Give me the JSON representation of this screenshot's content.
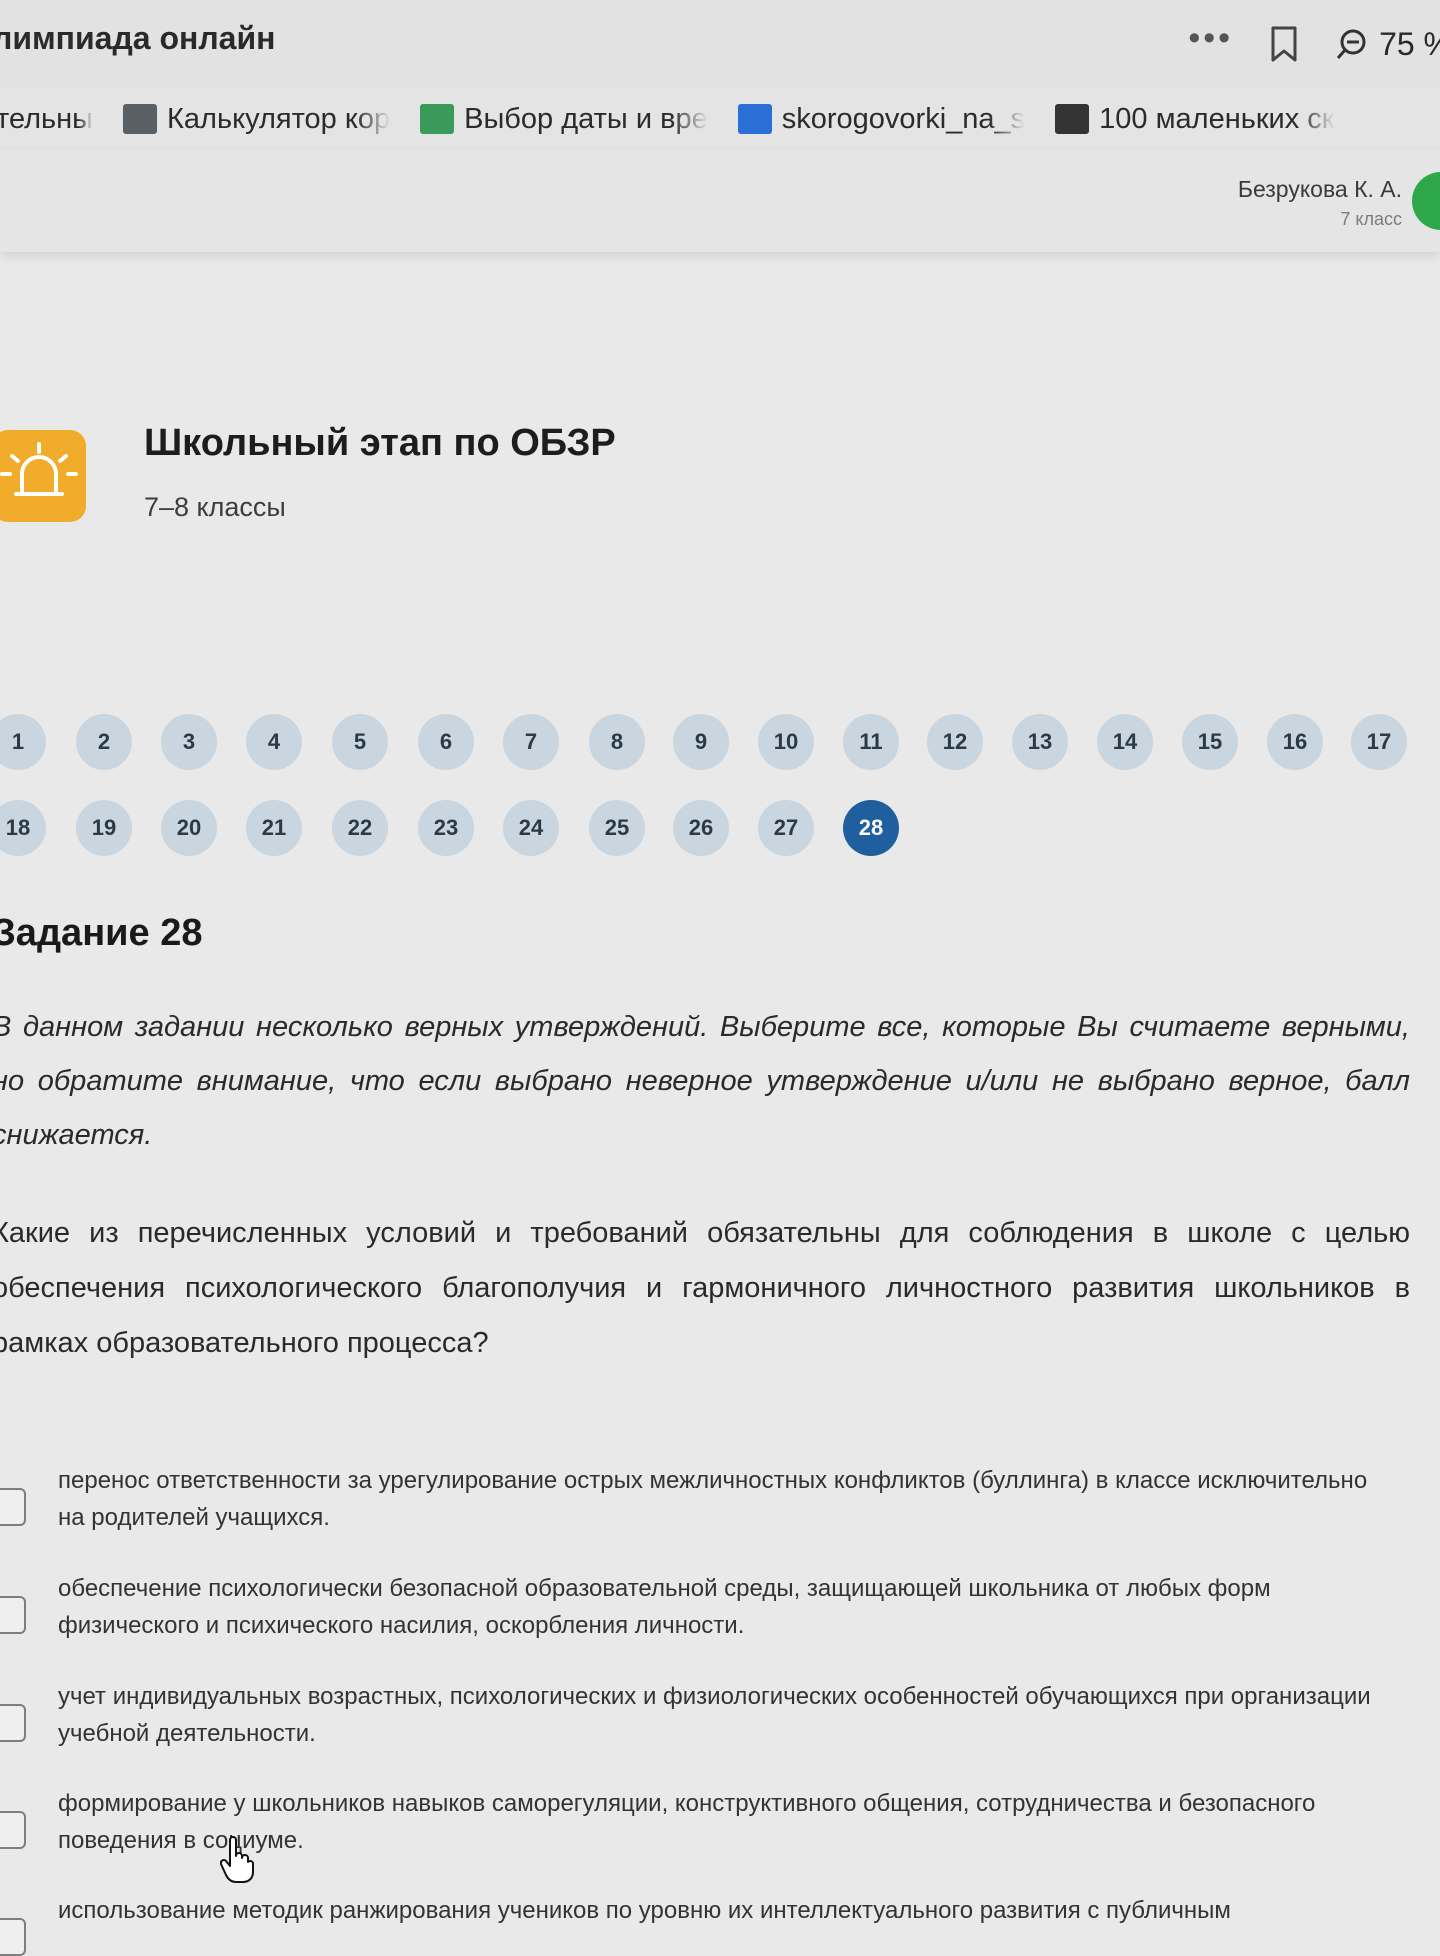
{
  "window": {
    "title": "лимпиада онлайн",
    "menu_icon": "more-dots-icon",
    "zoom": "75 %"
  },
  "bookmarks": [
    {
      "label": "тельны",
      "icon": "page-icon",
      "color": "#e4e4e4"
    },
    {
      "label": "Калькулятор кор",
      "icon": "calculator-icon",
      "color": "#5a5f66"
    },
    {
      "label": "Выбор даты и вре",
      "icon": "calendar-icon",
      "color": "#3a9a5a"
    },
    {
      "label": "skorogovorki_na_s",
      "icon": "document-icon",
      "color": "#2a6fd6"
    },
    {
      "label": "100 маленьких ск",
      "icon": "infinity-icon",
      "color": "#333333"
    }
  ],
  "user": {
    "name": "Безрукова К. А.",
    "class": "7 класс"
  },
  "olympiad": {
    "title": "Школьный этап по ОБЗР",
    "subtitle": "7–8 классы",
    "icon": "siren-icon",
    "icon_color": "#f0ac2a"
  },
  "question_nav": {
    "items": [
      "1",
      "2",
      "3",
      "4",
      "5",
      "6",
      "7",
      "8",
      "9",
      "10",
      "11",
      "12",
      "13",
      "14",
      "15",
      "16",
      "17",
      "18",
      "19",
      "20",
      "21",
      "22",
      "23",
      "24",
      "25",
      "26",
      "27",
      "28"
    ],
    "active": "28",
    "active_color": "#1f5f9e",
    "inactive_color": "#c9d6df"
  },
  "task": {
    "title": "Задание 28",
    "instruction": "В данном задании несколько верных утверждений. Выберите все, которые Вы считаете верными, но обратите внимание, что если выбрано неверное утверждение и/или не выбрано верное, балл снижается.",
    "question": "Какие из перечисленных условий и требований обязательны для соблюдения в школе с целью обеспечения психологического благополучия и гармоничного личностного развития школьников в рамках образовательного процесса?",
    "options": [
      "перенос ответственности за урегулирование острых межличностных конфликтов (буллинга) в классе исключительно на родителей учащихся.",
      "обеспечение психологически безопасной образовательной среды, защищающей школьника от любых форм физического и психического насилия, оскорбления личности.",
      "учет индивидуальных возрастных, психологических и физиологических особенностей обучающихся при организации учебной деятельности.",
      "формирование у школьников навыков саморегуляции, конструктивного общения, сотрудничества и безопасного поведения в социуме.",
      "использование методик ранжирования учеников по уровню их интеллектуального развития с публичным"
    ]
  }
}
